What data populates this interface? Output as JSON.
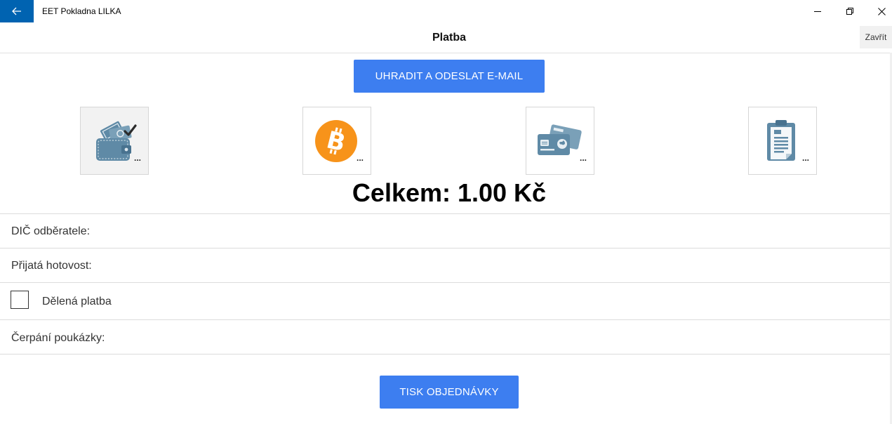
{
  "window": {
    "title": "EET Pokladna LILKA",
    "back_icon": "arrow-left-icon",
    "accent": "#0063b1"
  },
  "header": {
    "title": "Platba",
    "close_label": "Zavřít"
  },
  "actions": {
    "pay_email_label": "UHRADIT A ODESLAT E-MAIL",
    "print_order_label": "TISK OBJEDNÁVKY",
    "button_color": "#3d7ef0"
  },
  "payment_methods": [
    {
      "icon": "wallet-cash-icon",
      "more": "...",
      "selected": true
    },
    {
      "icon": "bitcoin-icon",
      "more": "...",
      "selected": false
    },
    {
      "icon": "credit-card-icon",
      "more": "...",
      "selected": false
    },
    {
      "icon": "clipboard-invoice-icon",
      "more": "...",
      "selected": false
    }
  ],
  "total": {
    "label": "Celkem: 1.00 Kč"
  },
  "form": {
    "dic_label": "DIČ odběratele:",
    "cash_label": "Přijatá hotovost:",
    "split_label": "Dělená platba",
    "split_checked": false,
    "voucher_label": "Čerpání poukázky:"
  }
}
